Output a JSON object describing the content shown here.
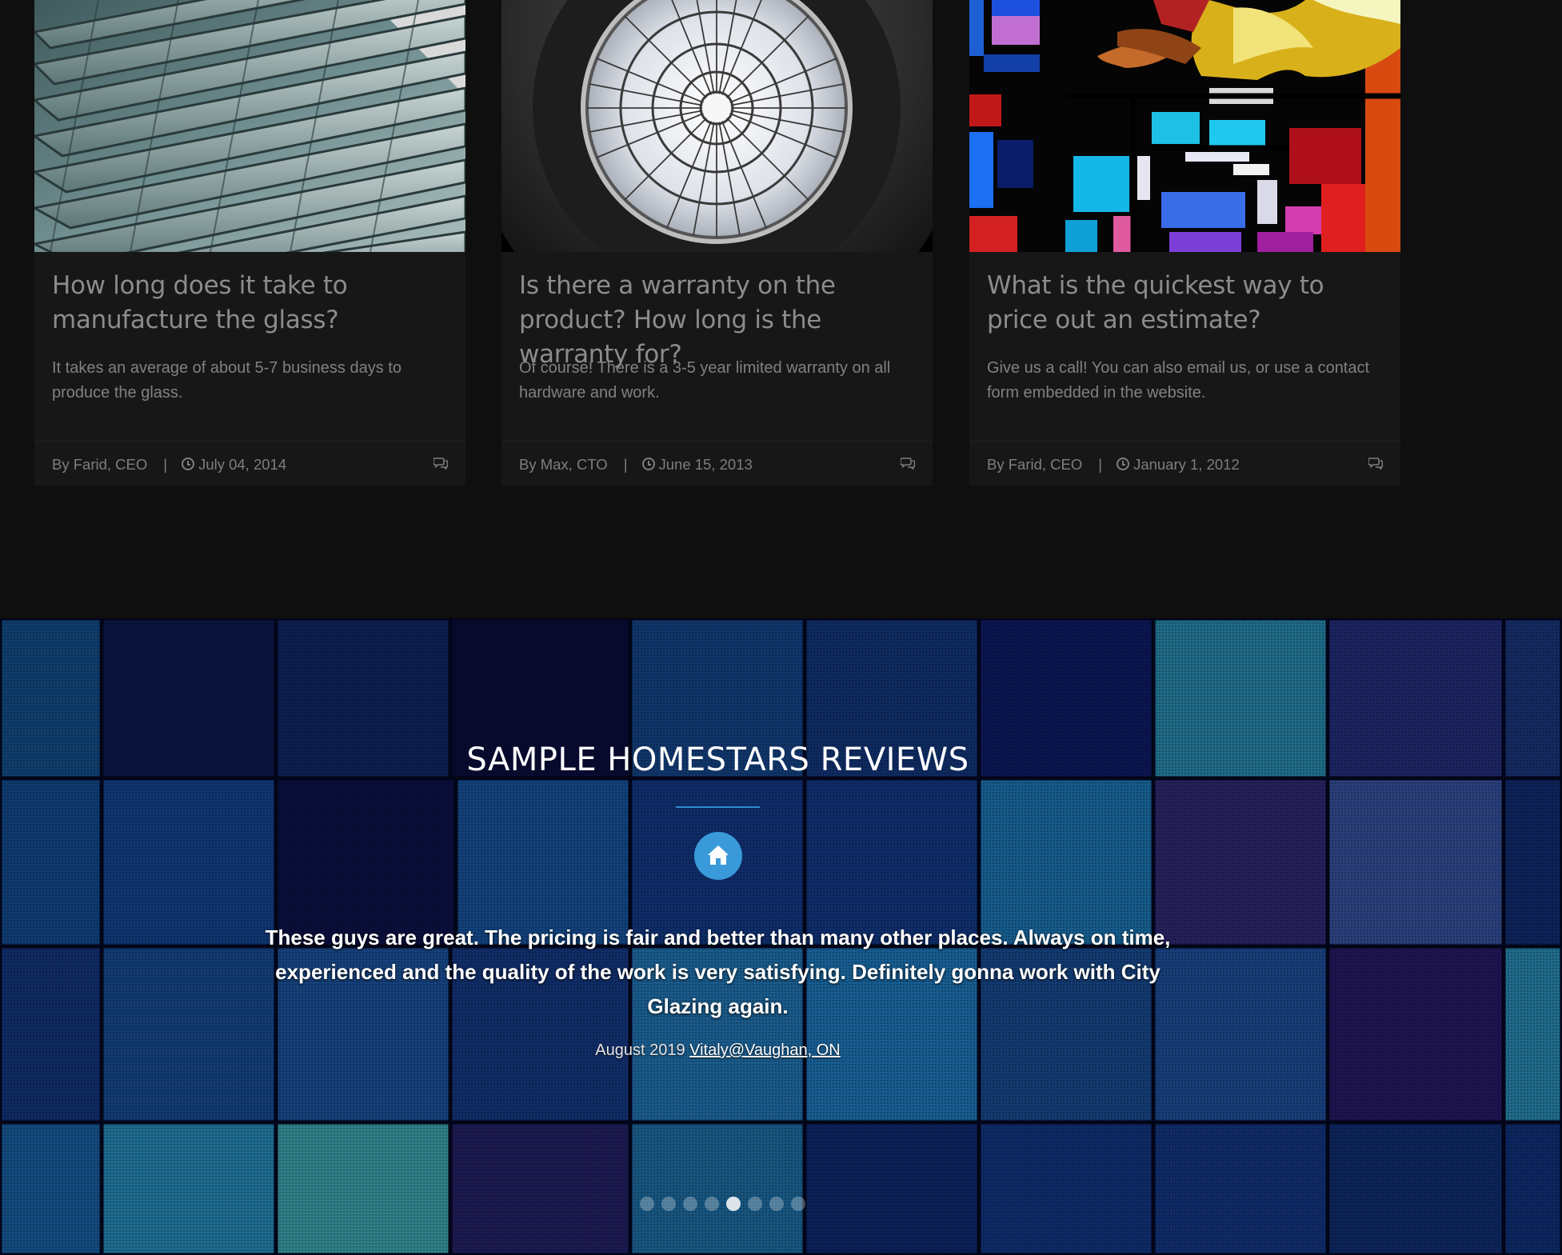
{
  "posts": [
    {
      "title": "How long does it take to manufacture the glass?",
      "text": "It takes an average of about 5-7 business days to produce the glass.",
      "author": "By Farid, CEO",
      "separator": "|",
      "date": "July 04, 2014",
      "image": "glass-facade-photo"
    },
    {
      "title": "Is there a warranty on the product? How long is the warranty for?",
      "text": "Of course! There is a 3-5 year limited warranty on all hardware and work.",
      "author": "By Max, CTO",
      "separator": "|",
      "date": "June 15, 2013",
      "image": "round-skylight-photo"
    },
    {
      "title": "What is the quickest way to price out an estimate?",
      "text": "Give us a call! You can also email us, or use a contact form embedded in the website.",
      "author": "By Farid, CEO",
      "separator": "|",
      "date": "January 1, 2012",
      "image": "stained-glass-photo"
    }
  ],
  "reviews": {
    "title": "SAMPLE HOMESTARS REVIEWS",
    "icon": "home-icon",
    "quote": "These guys are great. The pricing is fair and better than many other places. Always on time, experienced and the quality of the work is very satisfying. Definitely gonna work with City Glazing again.",
    "date": "August 2019",
    "author_link": "Vitaly@Vaughan, ON",
    "slides_total": 8,
    "active_slide": 5
  },
  "colors": {
    "page_bg": "#0f0f0f",
    "card_bg": "#171717",
    "accent": "#3a9ad9"
  }
}
